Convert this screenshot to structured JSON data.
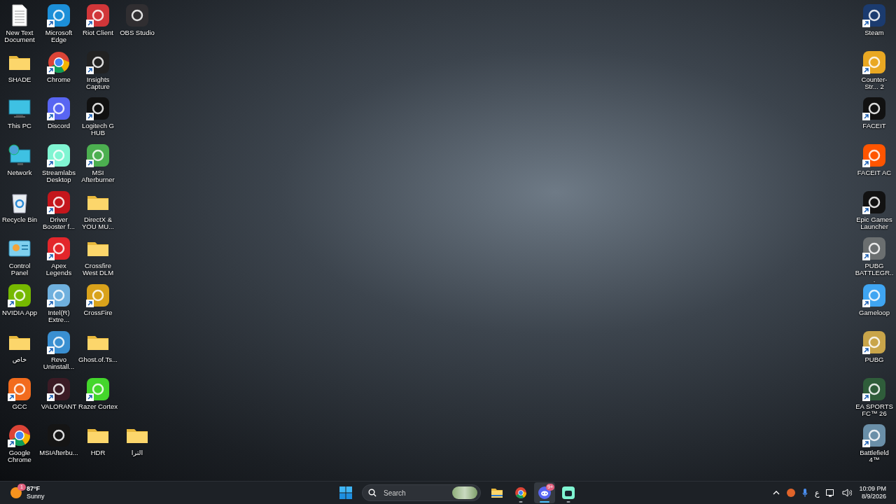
{
  "desktop": {
    "left_columns": [
      [
        {
          "label": "New Text Document",
          "kind": "document",
          "shortcut": false
        },
        {
          "label": "SHADE",
          "kind": "folder",
          "shortcut": false
        },
        {
          "label": "This PC",
          "kind": "monitor",
          "shortcut": false
        },
        {
          "label": "Network",
          "kind": "network",
          "shortcut": false
        },
        {
          "label": "Recycle Bin",
          "kind": "recycle",
          "shortcut": false
        },
        {
          "label": "Control Panel",
          "kind": "control",
          "shortcut": false
        },
        {
          "label": "NVIDIA App",
          "kind": "app",
          "color": "#76b900",
          "shortcut": true
        },
        {
          "label": "خاص",
          "kind": "folder",
          "shortcut": false
        },
        {
          "label": "GCC",
          "kind": "app",
          "color": "#f26b1d",
          "shortcut": true
        },
        {
          "label": "Google Chrome",
          "kind": "chrome",
          "shortcut": true
        }
      ],
      [
        {
          "label": "Microsoft Edge",
          "kind": "app",
          "color": "#1c8fd8",
          "shortcut": true
        },
        {
          "label": "Chrome",
          "kind": "chrome",
          "shortcut": true
        },
        {
          "label": "Discord",
          "kind": "app",
          "color": "#5865f2",
          "shortcut": true
        },
        {
          "label": "Streamlabs Desktop",
          "kind": "app",
          "color": "#80f5d2",
          "shortcut": true
        },
        {
          "label": "Driver Booster f...",
          "kind": "app",
          "color": "#c4161c",
          "shortcut": true
        },
        {
          "label": "Apex Legends",
          "kind": "app",
          "color": "#e3262b",
          "shortcut": true
        },
        {
          "label": "Intel(R) Extre...",
          "kind": "app",
          "color": "#6fb0de",
          "shortcut": true
        },
        {
          "label": "Revo Uninstall...",
          "kind": "app",
          "color": "#3a8fd1",
          "shortcut": true
        },
        {
          "label": "VALORANT",
          "kind": "app",
          "color": "#3b1b25",
          "shortcut": true
        },
        {
          "label": "MSIAfterbu...",
          "kind": "app",
          "color": "#151515",
          "shortcut": false
        }
      ],
      [
        {
          "label": "Riot Client",
          "kind": "app",
          "color": "#d13639",
          "shortcut": true
        },
        {
          "label": "Insights Capture",
          "kind": "app",
          "color": "#222222",
          "shortcut": true
        },
        {
          "label": "Logitech G HUB",
          "kind": "app",
          "color": "#111111",
          "shortcut": true
        },
        {
          "label": "MSI Afterburner",
          "kind": "app",
          "color": "#4caf50",
          "shortcut": true
        },
        {
          "label": "DirectX & YOU MU...",
          "kind": "folder",
          "shortcut": false
        },
        {
          "label": "Crossfire West DLM",
          "kind": "folder",
          "shortcut": false
        },
        {
          "label": "CrossFire",
          "kind": "app",
          "color": "#d9a21b",
          "shortcut": true
        },
        {
          "label": "Ghost.of.Ts...",
          "kind": "folder",
          "shortcut": false
        },
        {
          "label": "Razer Cortex",
          "kind": "app",
          "color": "#44d62c",
          "shortcut": true
        },
        {
          "label": "HDR",
          "kind": "folder",
          "shortcut": false
        }
      ],
      [
        {
          "label": "OBS Studio",
          "kind": "app",
          "color": "#302e31",
          "shortcut": false
        },
        {
          "label": "الترا",
          "kind": "folder",
          "shortcut": false
        }
      ]
    ],
    "right_column": [
      {
        "label": "Steam",
        "kind": "app",
        "color": "#1b3b6f",
        "shortcut": true
      },
      {
        "label": "Counter-Str... 2",
        "kind": "app",
        "color": "#e9a823",
        "shortcut": true
      },
      {
        "label": "FACEIT",
        "kind": "app",
        "color": "#111111",
        "shortcut": true
      },
      {
        "label": "FACEIT AC",
        "kind": "app",
        "color": "#ff5500",
        "shortcut": true
      },
      {
        "label": "Epic Games Launcher",
        "kind": "app",
        "color": "#121212",
        "shortcut": true
      },
      {
        "label": "PUBG BATTLEGR...",
        "kind": "app",
        "color": "#6b6f70",
        "shortcut": true
      },
      {
        "label": "Gameloop",
        "kind": "app",
        "color": "#3fa5f2",
        "shortcut": true
      },
      {
        "label": "PUBG",
        "kind": "app",
        "color": "#c9a54a",
        "shortcut": true
      },
      {
        "label": "EA SPORTS FC™ 26",
        "kind": "app",
        "color": "#2f5d3a",
        "shortcut": true
      },
      {
        "label": "Battlefield 4™",
        "kind": "app",
        "color": "#6a8fa8",
        "shortcut": true
      }
    ]
  },
  "taskbar": {
    "weather": {
      "temperature": "87°F",
      "condition": "Sunny",
      "badge": "1"
    },
    "search": {
      "placeholder": "Search"
    },
    "apps": [
      {
        "kind": "explorer",
        "open": false,
        "focused": false
      },
      {
        "kind": "chrome",
        "open": true,
        "focused": false
      },
      {
        "kind": "discord",
        "open": true,
        "focused": true,
        "badge": "9+"
      },
      {
        "kind": "streamlabs",
        "open": true,
        "focused": false
      }
    ],
    "tray": {
      "language": "ع",
      "time": "10:09 PM",
      "date": "8/9/2026"
    }
  }
}
